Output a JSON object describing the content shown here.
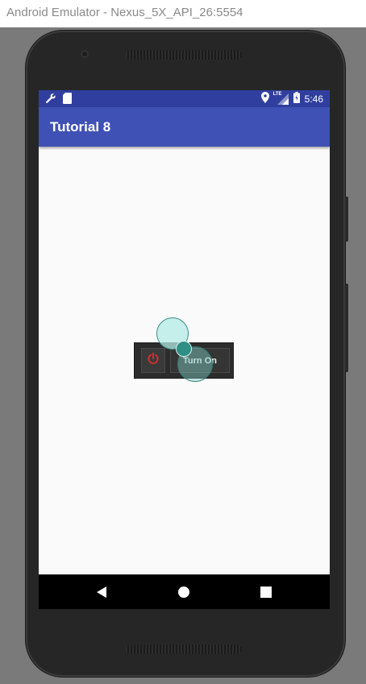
{
  "window": {
    "title": "Android Emulator - Nexus_5X_API_26:5554"
  },
  "status_bar": {
    "left_icons": [
      "wrench-icon",
      "sd-card-icon"
    ],
    "right_icons": [
      "location-icon",
      "lte-signal-icon",
      "battery-icon"
    ],
    "network_label": "LTE",
    "time": "5:46"
  },
  "app_bar": {
    "title": "Tutorial 8"
  },
  "toggle": {
    "power_icon": "power-icon",
    "label": "Turn On"
  },
  "nav_bar": {
    "items": [
      "back-icon",
      "home-icon",
      "recents-icon"
    ]
  },
  "colors": {
    "status_bar": "#303f9f",
    "app_bar": "#3f51b5",
    "screen_bg": "#fafafa",
    "power_icon": "#d32f2f",
    "touch_indicator": "#80cbc4"
  }
}
